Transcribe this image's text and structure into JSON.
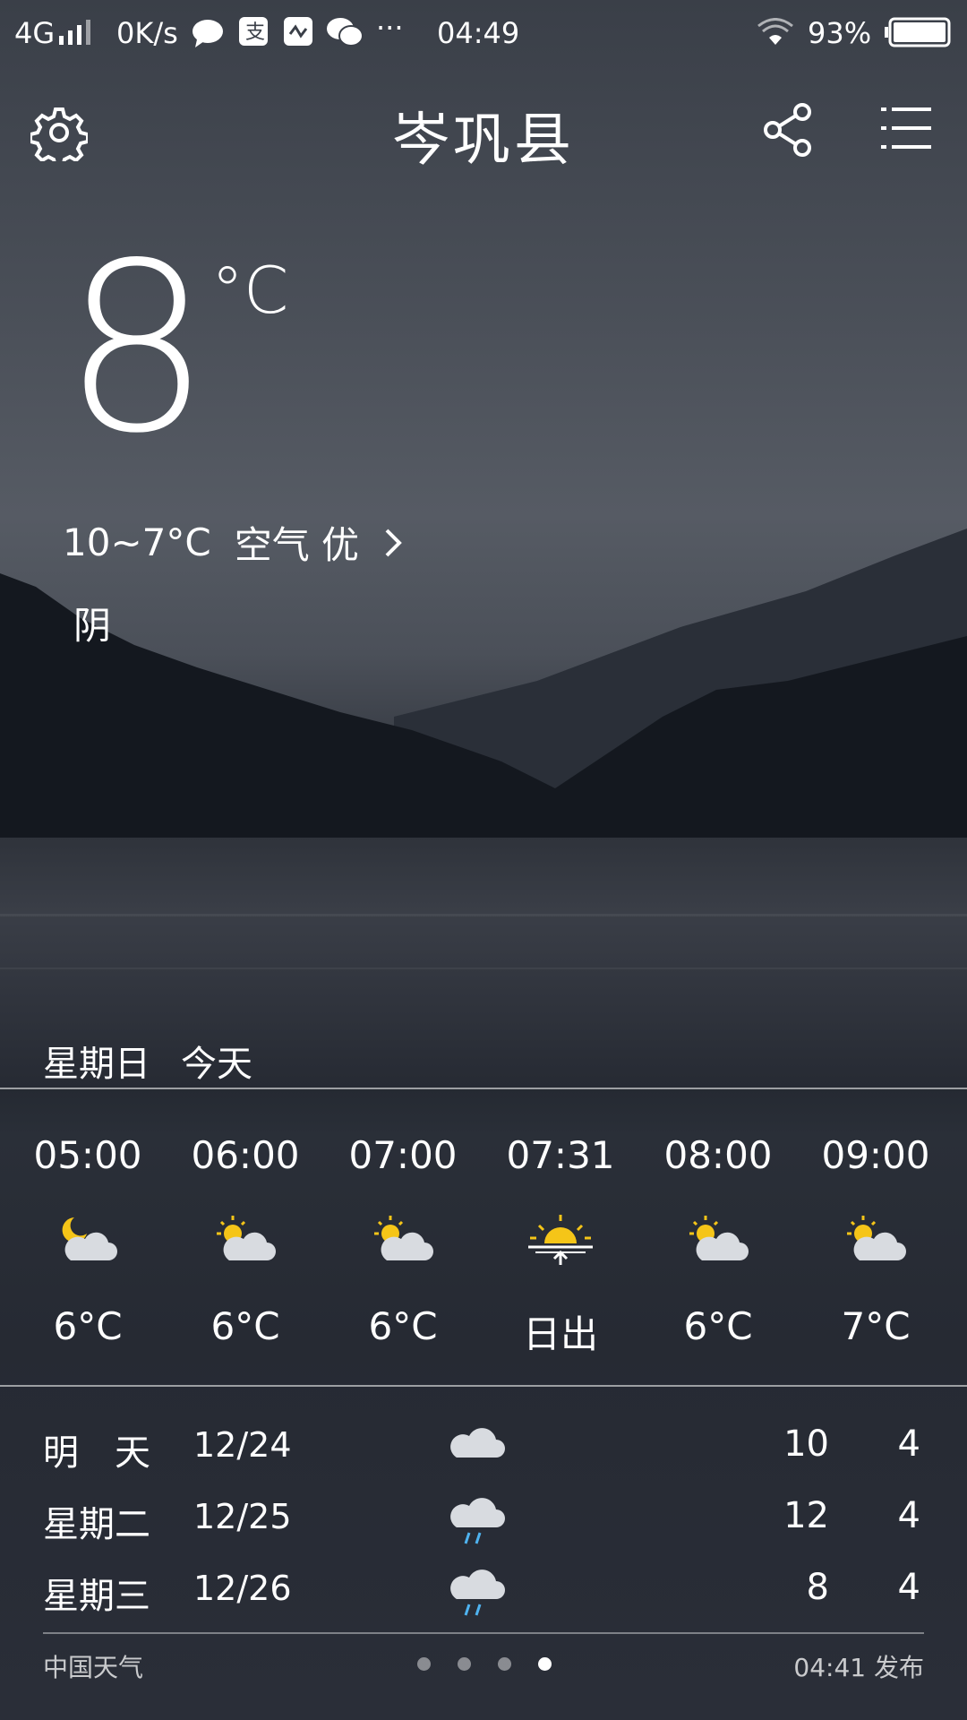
{
  "status_bar": {
    "network": "4G",
    "speed": "0K/s",
    "more": "···",
    "time": "04:49",
    "battery": "93%"
  },
  "header": {
    "city": "岑巩县",
    "icons": [
      "gear-icon",
      "share-icon",
      "menu-icon"
    ]
  },
  "current": {
    "temperature": "8",
    "unit": "°C",
    "range": "10~7°C",
    "air_quality": "空气 优",
    "condition": "阴"
  },
  "today": {
    "weekday": "星期日",
    "label": "今天"
  },
  "hourly": [
    {
      "time": "05:00",
      "icon": "night-partly-cloudy-icon",
      "value": "6°C"
    },
    {
      "time": "06:00",
      "icon": "partly-cloudy-icon",
      "value": "6°C"
    },
    {
      "time": "07:00",
      "icon": "partly-cloudy-icon",
      "value": "6°C"
    },
    {
      "time": "07:31",
      "icon": "sunrise-icon",
      "value": "日出"
    },
    {
      "time": "08:00",
      "icon": "partly-cloudy-icon",
      "value": "6°C"
    },
    {
      "time": "09:00",
      "icon": "partly-cloudy-icon",
      "value": "7°C"
    }
  ],
  "daily": [
    {
      "day": "明　天",
      "date": "12/24",
      "icon": "cloudy-icon",
      "high": "10",
      "low": "4"
    },
    {
      "day": "星期二",
      "date": "12/25",
      "icon": "rain-icon",
      "high": "12",
      "low": "4"
    },
    {
      "day": "星期三",
      "date": "12/26",
      "icon": "rain-icon",
      "high": "8",
      "low": "4"
    }
  ],
  "footer": {
    "source": "中国天气",
    "published": "04:41 发布",
    "pages": 4,
    "active_page": 4
  },
  "colors": {
    "sun": "#f5c518",
    "cloud": "#d8dbe0",
    "rain": "#4fb3f0"
  }
}
